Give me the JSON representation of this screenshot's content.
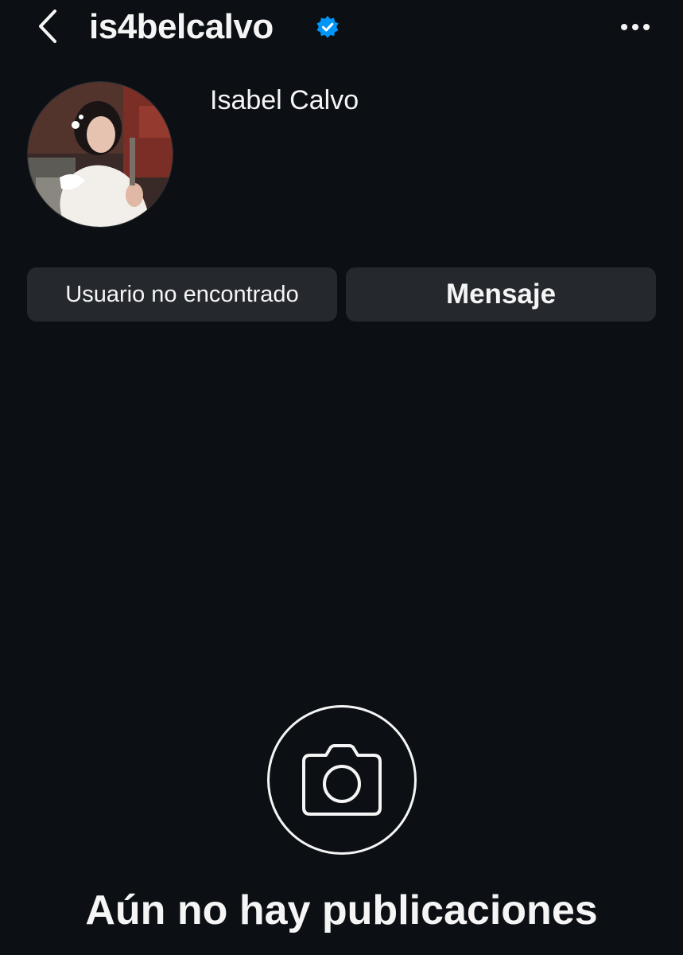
{
  "header": {
    "username": "is4belcalvo",
    "back_icon": "chevron-left-icon",
    "verified_icon": "verified-badge-icon",
    "more_icon": "more-horizontal-icon"
  },
  "profile": {
    "display_name": "Isabel Calvo",
    "avatar_alt": "Isabel Calvo"
  },
  "actions": {
    "user_status_label": "Usuario no encontrado",
    "message_label": "Mensaje"
  },
  "empty_state": {
    "icon": "camera-icon",
    "title": "Aún no hay publicaciones"
  },
  "colors": {
    "background": "#0c1014",
    "button": "#25292e",
    "text": "#f5f5f5",
    "verified": "#0095f6"
  }
}
